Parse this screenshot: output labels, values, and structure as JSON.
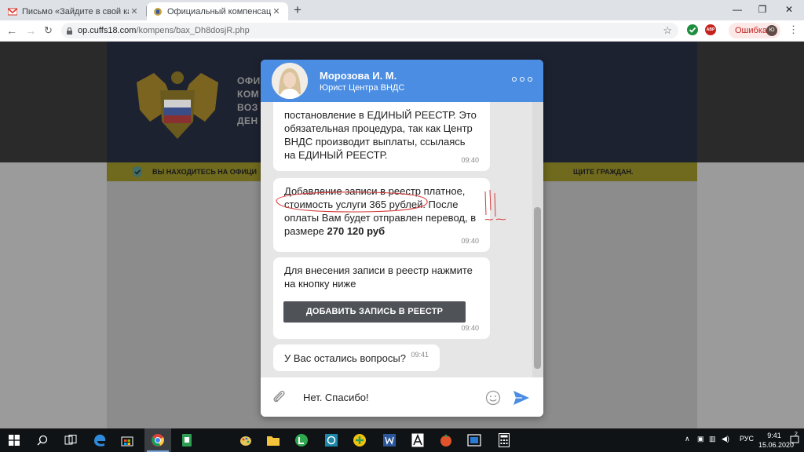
{
  "browser": {
    "tabs": [
      {
        "title": "Письмо «Зайдите в свой кабин…",
        "active": false
      },
      {
        "title": "Официальный компенсационн…",
        "active": true
      }
    ],
    "url_host": "op.cuffs18.com",
    "url_path": "/kompens/bax_Dh8dosjR.php",
    "profile_label": "Ошибка",
    "profile_initials": "Ю",
    "adblock_label": "ABP"
  },
  "page": {
    "banner_lines": [
      "ОФИ",
      "КОМ",
      "ВОЗ",
      "ДЕН"
    ],
    "notice_left": "ВЫ НАХОДИТЕСЬ НА ОФИЦИ",
    "notice_right": "ЩИТЕ ГРАЖДАН."
  },
  "chat": {
    "agent_name": "Морозова И. М.",
    "agent_role": "Юрист Центра ВНДС",
    "messages": [
      {
        "text": "постановление в ЕДИНЫЙ РЕЕСТР. Это обязательная процедура, так как Центр ВНДС производит выплаты, ссылаясь на ЕДИНЫЙ РЕЕСТР.",
        "time": "09:40"
      },
      {
        "text_before": "Добавление записи в реестр платное, стоимость услуги 365 рублей. После оплаты Вам будет отправлен перевод, в размере ",
        "text_bold": "270 120 руб",
        "time": "09:40"
      },
      {
        "text": "Для внесения записи в реестр нажмите на кнопку ниже",
        "button": "ДОБАВИТЬ ЗАПИСЬ В РЕЕСТР",
        "time": "09:40"
      },
      {
        "text": "У Вас остались вопросы?",
        "time": "09:41"
      }
    ],
    "composer_value": "Нет. Спасибо!",
    "accent": "#4a8de3"
  },
  "taskbar": {
    "language": "РУС",
    "time": "9:41",
    "date": "15.06.2020",
    "tray_badge": "2"
  }
}
